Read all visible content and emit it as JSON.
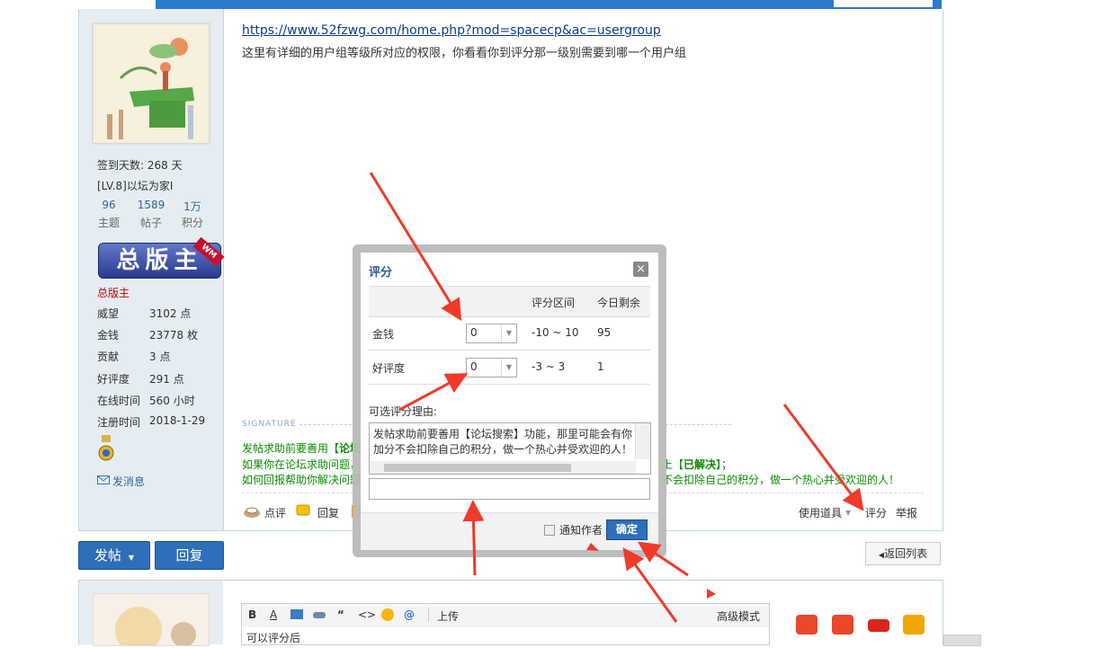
{
  "nav": {
    "tabs": [
      "",
      "",
      "",
      "",
      "",
      "",
      ""
    ],
    "search_placeholder": ""
  },
  "post": {
    "link": "https://www.52fzwg.com/home.php?mod=spacecp&ac=usergroup",
    "content": "这里有详细的用户组等级所对应的权限，你看看你到评分那一级别需要到哪一个用户组",
    "signature_label": "SIGNATURE",
    "sig_line1_a": "发帖求助前要善用【",
    "sig_line1_b": "论坛",
    "sig_line2_a": "如果你在论坛求助问题，",
    "sig_line2_b": "上【",
    "sig_line2_c": "已解决",
    "sig_line2_d": "】；",
    "sig_line3_a": "如何回报帮助你解决问题",
    "sig_line3_b": "不会扣除自己的积分，做一个热心并受欢迎的人！",
    "actions": {
      "dianping": "点评",
      "huifu": "回复",
      "tools": "使用道具",
      "rate": "评分",
      "report": "举报"
    }
  },
  "user": {
    "checkin": "签到天数: 268 天",
    "level": "[LV.8]以坛为家I",
    "stats": [
      {
        "num": "96",
        "label": "主题"
      },
      {
        "num": "1589",
        "label": "帖子"
      },
      {
        "num": "1万",
        "label": "积分"
      }
    ],
    "badge": "总版主",
    "badge_tag": "WM",
    "group": "总版主",
    "info": [
      {
        "k": "威望",
        "v": "3102 点"
      },
      {
        "k": "金钱",
        "v": "23778 枚"
      },
      {
        "k": "贡献",
        "v": "3 点"
      },
      {
        "k": "好评度",
        "v": "291 点"
      },
      {
        "k": "在线时间",
        "v": "560 小时"
      },
      {
        "k": "注册时间",
        "v": "2018-1-29"
      }
    ],
    "message": "发消息"
  },
  "buttons": {
    "post": "发帖",
    "reply": "回复",
    "back": "返回列表"
  },
  "editor": {
    "upload": "上传",
    "advanced": "高级模式",
    "body": "可以评分后"
  },
  "modal": {
    "title": "评分",
    "close": "×",
    "col_range": "评分区间",
    "col_remain": "今日剩余",
    "rows": [
      {
        "name": "金钱",
        "value": "0",
        "range": "-10 ~ 10",
        "remain": "95"
      },
      {
        "name": "好评度",
        "value": "0",
        "range": "-3 ~ 3",
        "remain": "1"
      }
    ],
    "reason_label": "可选评分理由:",
    "reason_text_1": "发帖求助前要善用【论坛搜索】功能，那里可能会有你",
    "reason_text_2": "加分不会扣除自己的积分，做一个热心并受欢迎的人！",
    "notify": "通知作者",
    "confirm": "确定"
  },
  "colors": {
    "accent": "#2d6fb8",
    "arrow": "#f03a2a",
    "nav": "#2b7acd"
  }
}
